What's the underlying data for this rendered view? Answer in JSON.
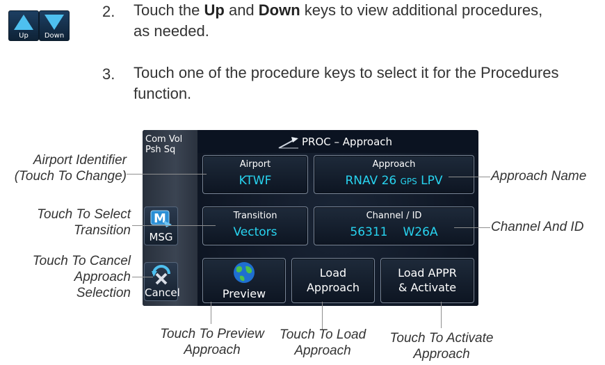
{
  "keys": {
    "up_label": "Up",
    "down_label": "Down",
    "up_icon": "up-arrow-icon",
    "down_icon": "down-arrow-icon"
  },
  "steps": [
    {
      "num": "2.",
      "parts": [
        "Touch the ",
        "Up",
        " and ",
        "Down",
        " keys to view additional procedures,"
      ],
      "line2": "as needed."
    },
    {
      "num": "3.",
      "line1": "Touch one of the procedure keys to select it for the Procedures",
      "line2": "function."
    }
  ],
  "screen": {
    "com_vol": "Com Vol",
    "psh_sq": "Psh Sq",
    "title": "PROC – Approach",
    "msg_label": "MSG",
    "cancel_label": "Cancel",
    "airport": {
      "label": "Airport",
      "value": "KTWF"
    },
    "approach": {
      "label": "Approach",
      "value_a": "RNAV 26 ",
      "value_b": "GPS",
      "value_c": " LPV"
    },
    "transition": {
      "label": "Transition",
      "value": "Vectors"
    },
    "channel": {
      "label": "Channel / ID",
      "value_a": "56311",
      "value_b": "W26A"
    },
    "preview_label": "Preview",
    "load_approach": [
      "Load",
      "Approach"
    ],
    "load_activate": [
      "Load APPR",
      "& Activate"
    ],
    "accent_color": "#28d4f0"
  },
  "callouts": {
    "airport_identifier": [
      "Airport Identifier",
      "(Touch To Change)"
    ],
    "select_transition": [
      "Touch To Select",
      "Transition"
    ],
    "cancel_approach": [
      "Touch To Cancel",
      "Approach",
      "Selection"
    ],
    "approach_name": "Approach Name",
    "channel_and_id": "Channel And ID",
    "preview_approach": [
      "Touch To Preview",
      "Approach"
    ],
    "load_approach": [
      "Touch To Load",
      "Approach"
    ],
    "activate_approach": [
      "Touch To Activate",
      "Approach"
    ]
  }
}
